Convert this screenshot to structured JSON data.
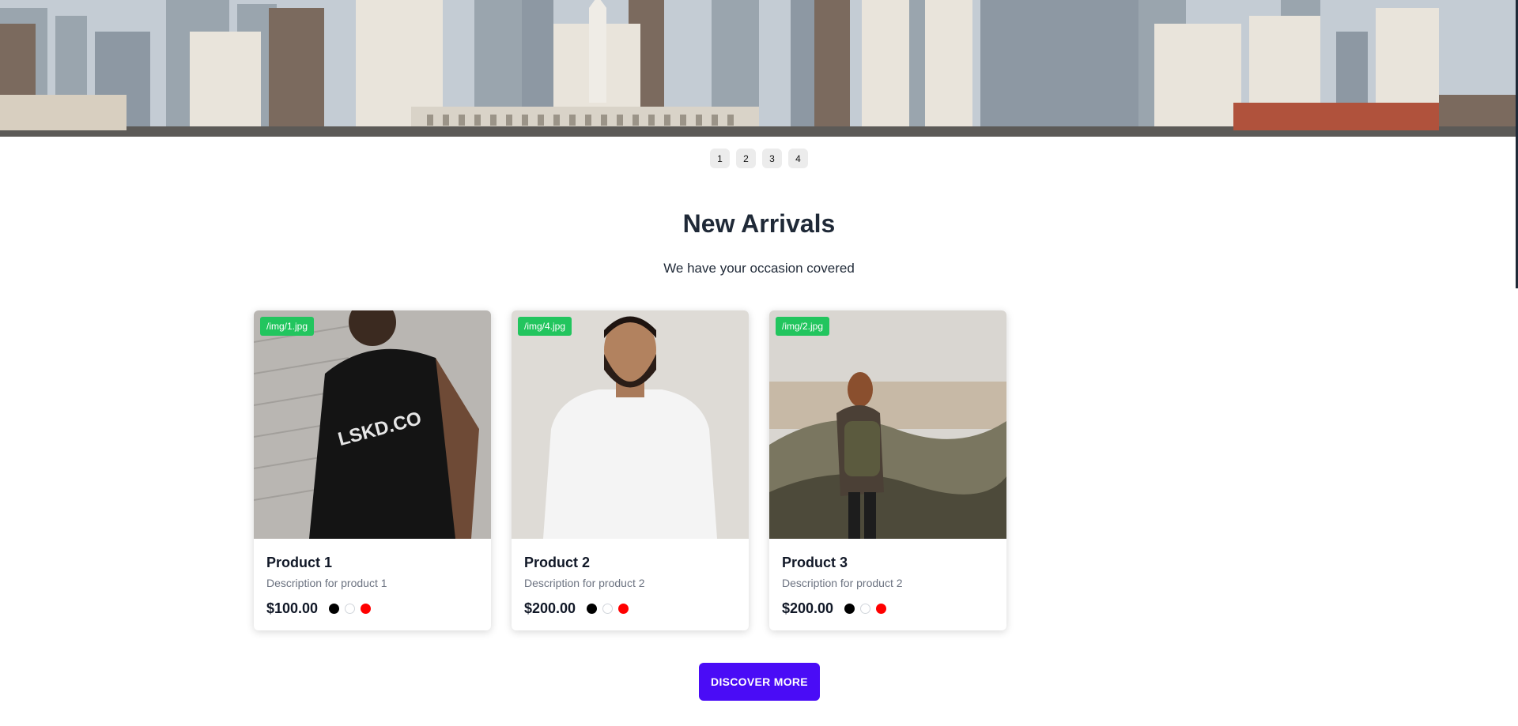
{
  "slider": {
    "pages": [
      "1",
      "2",
      "3",
      "4"
    ]
  },
  "section": {
    "title": "New Arrivals",
    "subtitle": "We have your occasion covered"
  },
  "products": [
    {
      "badge": "/img/1.jpg",
      "name": "Product 1",
      "description": "Description for product 1",
      "price": "$100.00",
      "image_subject": "person-black-tshirt-back",
      "swatches": [
        "#000000",
        "#ffffff",
        "#ff0000"
      ]
    },
    {
      "badge": "/img/4.jpg",
      "name": "Product 2",
      "description": "Description for product 2",
      "price": "$200.00",
      "image_subject": "man-white-tshirt",
      "swatches": [
        "#000000",
        "#ffffff",
        "#ff0000"
      ]
    },
    {
      "badge": "/img/2.jpg",
      "name": "Product 3",
      "description": "Description for product 2",
      "price": "$200.00",
      "image_subject": "hiker-with-backpack",
      "swatches": [
        "#000000",
        "#ffffff",
        "#ff0000"
      ]
    }
  ],
  "cta": {
    "label": "DISCOVER MORE"
  },
  "colors": {
    "accent": "#4a0cf6",
    "badge": "#22c55e"
  }
}
